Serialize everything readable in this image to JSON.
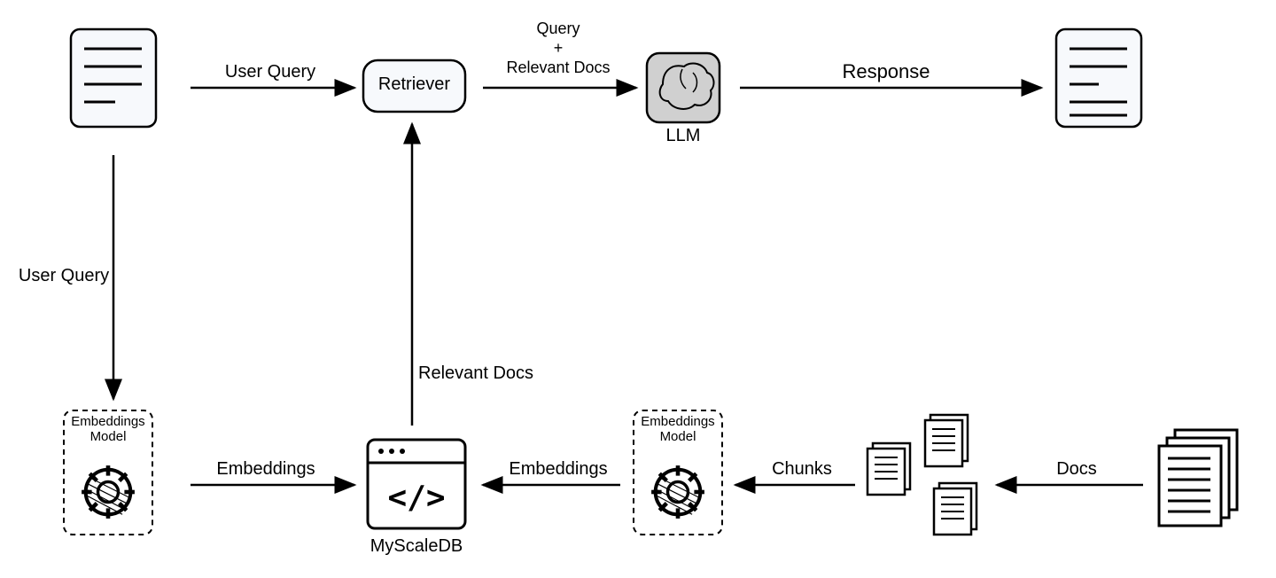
{
  "nodes": {
    "user_query_doc": "User Query Document",
    "retriever": "Retriever",
    "llm": "LLM",
    "response_doc": "Response Document",
    "embeddings_model_left": "Embeddings\nModel",
    "embeddings_model_right": "Embeddings\nModel",
    "myscaledb": "MyScaleDB",
    "chunks_docs": "Document Chunks",
    "source_docs": "Source Documents"
  },
  "edges": {
    "user_query_to_retriever": "User Query",
    "retriever_to_llm_line1": "Query",
    "retriever_to_llm_plus": "+",
    "retriever_to_llm_line2": "Relevant Docs",
    "llm_to_response": "Response",
    "user_query_down": "User Query",
    "embeddings_left_to_db": "Embeddings",
    "db_to_retriever": "Relevant Docs",
    "embeddings_right_to_db": "Embeddings",
    "chunks_to_embeddings": "Chunks",
    "docs_to_chunks": "Docs"
  },
  "labels": {
    "myscaledb_caption": "MyScaleDB",
    "llm_caption": "LLM"
  }
}
